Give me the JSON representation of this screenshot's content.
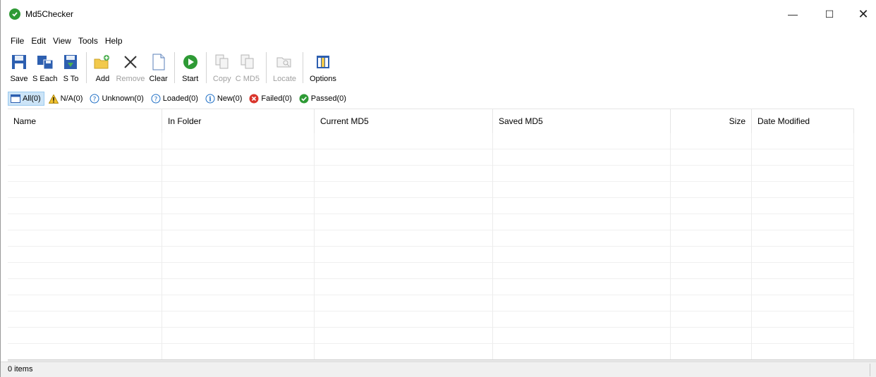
{
  "window": {
    "title": "Md5Checker",
    "minimize_glyph": "—",
    "maximize_glyph": "☐",
    "close_glyph": "✕"
  },
  "menu": [
    "File",
    "Edit",
    "View",
    "Tools",
    "Help"
  ],
  "toolbar": {
    "save": "Save",
    "save_each": "S Each",
    "save_to": "S To",
    "add": "Add",
    "remove": "Remove",
    "clear": "Clear",
    "start": "Start",
    "copy": "Copy",
    "copy_md5": "C MD5",
    "locate": "Locate",
    "options": "Options"
  },
  "filters": {
    "all": "All(0)",
    "na": "N/A(0)",
    "unknown": "Unknown(0)",
    "loaded": "Loaded(0)",
    "new": "New(0)",
    "failed": "Failed(0)",
    "passed": "Passed(0)"
  },
  "columns": {
    "name": "Name",
    "in_folder": "In Folder",
    "current_md5": "Current MD5",
    "saved_md5": "Saved MD5",
    "size": "Size",
    "date_modified": "Date Modified"
  },
  "status": {
    "items": "0 items"
  },
  "colors": {
    "passed_green": "#2e9a35",
    "failed_red": "#d9342b",
    "info_blue": "#1f6fc5",
    "warning_yellow": "#f4c430",
    "selection_blue": "#cce4f7"
  }
}
